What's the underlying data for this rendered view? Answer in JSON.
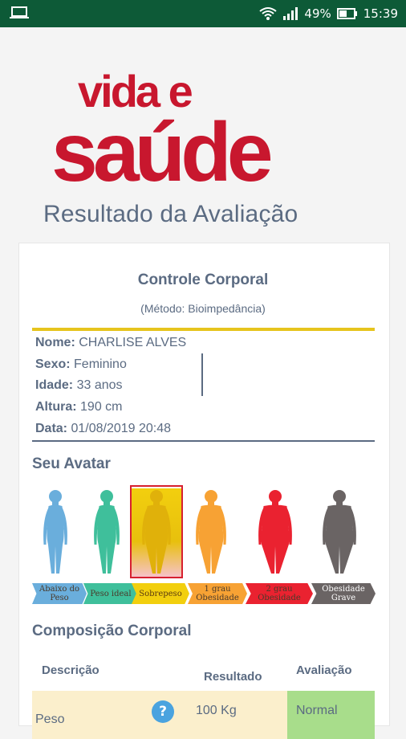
{
  "status_bar": {
    "battery": "49%",
    "time": "15:39",
    "icons": [
      "laptop-icon",
      "wifi-icon",
      "signal-icon",
      "battery-icon"
    ]
  },
  "logo": {
    "line1": "vida e",
    "line2": "saúde",
    "color": "#c8172e"
  },
  "page_title": "Resultado da Avaliação",
  "card": {
    "title": "Controle Corporal",
    "subtitle": "(Método: Bioimpedância)",
    "info": {
      "nome_label": "Nome:",
      "nome": "CHARLISE ALVES",
      "sexo_label": "Sexo:",
      "sexo": "Feminino",
      "idade_label": "Idade:",
      "idade": "33 anos",
      "altura_label": "Altura:",
      "altura": "190 cm",
      "data_label": "Data:",
      "data": "01/08/2019 20:48"
    },
    "avatar_section_title": "Seu Avatar",
    "avatars": [
      {
        "label": "Abaixo do Peso",
        "color": "#6aaedc",
        "ribbon": "#6aaedc"
      },
      {
        "label": "Peso ideal",
        "color": "#3fbf9b",
        "ribbon": "#3fbf9b"
      },
      {
        "label": "Sobrepeso",
        "color": "#f2cf0e",
        "ribbon": "#f2cf0e",
        "selected": true
      },
      {
        "label": "1 grau Obesidade",
        "color": "#f7a234",
        "ribbon": "#f7a234"
      },
      {
        "label": "2 grau Obesidade",
        "color": "#ea2230",
        "ribbon": "#ea2230"
      },
      {
        "label": "Obesidade Grave",
        "color": "#6a6464",
        "ribbon": "#6a6464"
      }
    ],
    "composition_title": "Composição Corporal",
    "table": {
      "headers": [
        "Descrição",
        "Resultado",
        "Avaliação"
      ],
      "rows": [
        {
          "descricao": "Peso",
          "resultado": "100 Kg",
          "avaliacao": "Normal"
        }
      ],
      "help_symbol": "?"
    }
  }
}
